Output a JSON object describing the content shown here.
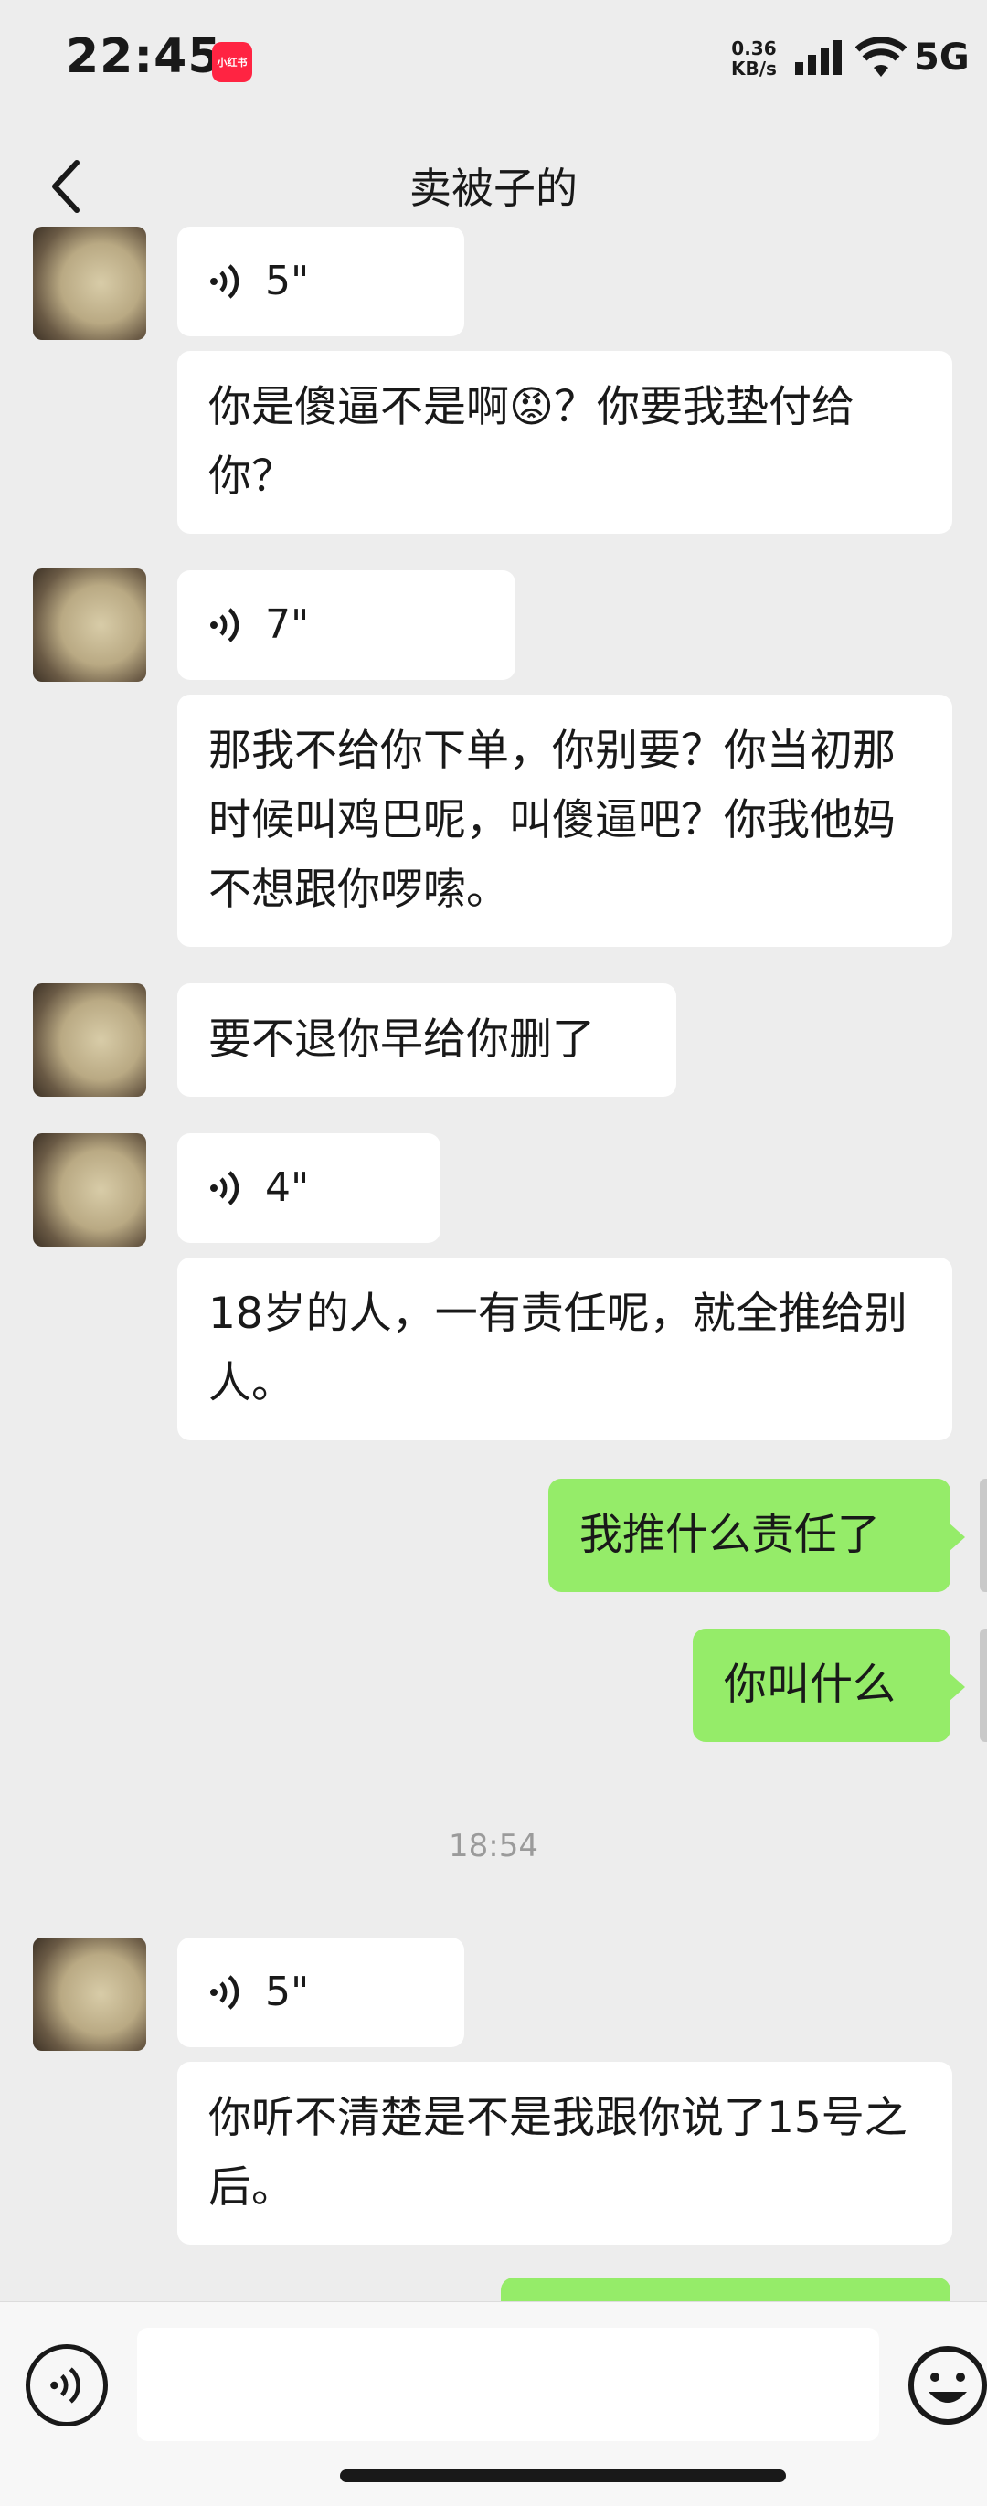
{
  "status_bar": {
    "time": "22:45",
    "app_badge": "小红书",
    "net_speed_value": "0.36",
    "net_speed_unit": "KB/s",
    "network": "5G"
  },
  "header": {
    "title": "卖被子的"
  },
  "messages": [
    {
      "side": "them",
      "type": "voice",
      "duration": "5\""
    },
    {
      "side": "them",
      "type": "text",
      "text": "你是傻逼不是啊😡？你要我垫付给你？"
    },
    {
      "side": "them",
      "type": "voice",
      "duration": "7\""
    },
    {
      "side": "them",
      "type": "text",
      "text": "那我不给你下单，你别要？你当初那时候叫鸡巴呢，叫傻逼吧？你我他妈不想跟你啰嗦。"
    },
    {
      "side": "them",
      "type": "text",
      "text": "要不退你早给你删了"
    },
    {
      "side": "them",
      "type": "voice",
      "duration": "4\""
    },
    {
      "side": "them",
      "type": "text",
      "text": "18岁的人，一有责任呢，就全推给别人。"
    },
    {
      "side": "me",
      "type": "text",
      "text": "我推什么责任了"
    },
    {
      "side": "me",
      "type": "text",
      "text": "你叫什么"
    },
    {
      "type": "timestamp",
      "text": "18:54"
    },
    {
      "side": "them",
      "type": "voice",
      "duration": "5\""
    },
    {
      "side": "them",
      "type": "text",
      "text": "你听不清楚是不是我跟你说了15号之后。"
    }
  ],
  "icons": {
    "back": "chevron-left-icon",
    "voice_toggle": "voice-icon",
    "emoji": "emoji-icon"
  },
  "colors": {
    "background": "#ededed",
    "my_bubble": "#95ec69",
    "their_bubble": "#ffffff"
  }
}
